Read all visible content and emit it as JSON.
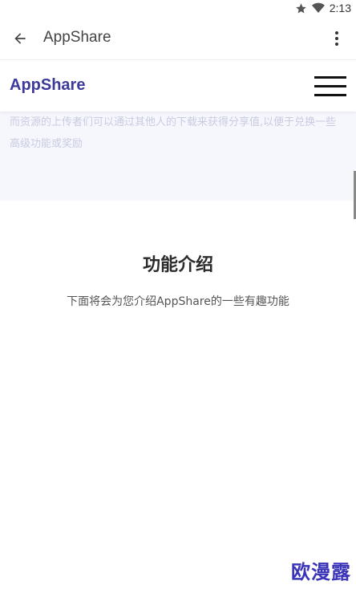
{
  "status_bar": {
    "time": "2:13",
    "icons": [
      "star-icon",
      "wifi-icon"
    ]
  },
  "toolbar": {
    "title": "AppShare",
    "back_icon": "arrow-left-icon",
    "more_icon": "more-vert-icon"
  },
  "site_header": {
    "brand": "AppShare",
    "menu_icon": "hamburger-menu-icon"
  },
  "hero": {
    "text": "而资源的上传者们可以通过其他人的下载来获得分享值,以便于兑换一些高级功能或奖励"
  },
  "features": {
    "heading": "功能介绍",
    "subtitle": "下面将会为您介绍AppShare的一些有趣功能"
  },
  "watermark": "欧漫露",
  "colors": {
    "brand": "#3d3a9c",
    "hero_bg": "#f6f7fd",
    "watermark": "#3a34b8"
  }
}
